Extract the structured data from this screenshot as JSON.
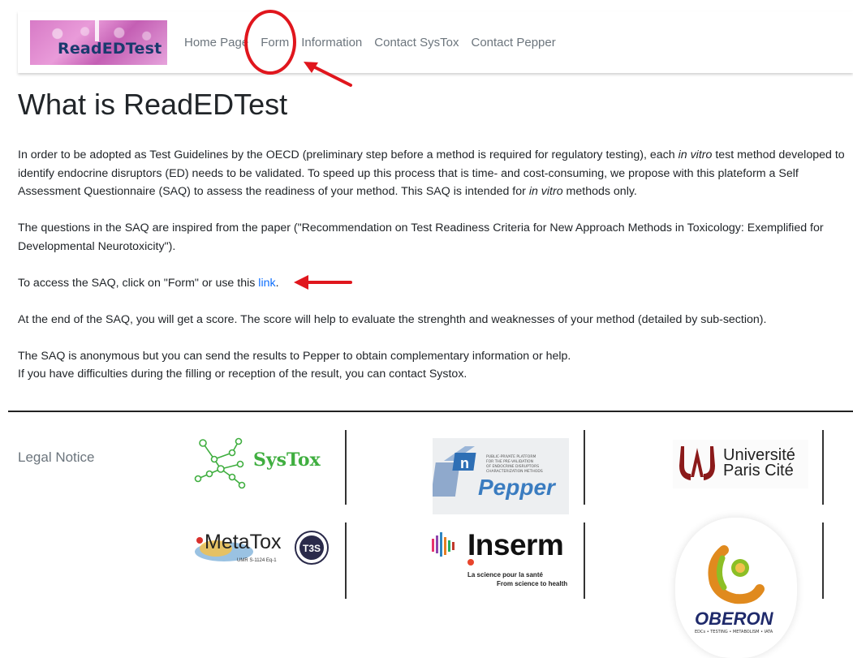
{
  "navbar": {
    "logo_text": "ReadEDTest",
    "links": [
      "Home Page",
      "Form",
      "Information",
      "Contact SysTox",
      "Contact Pepper"
    ]
  },
  "main": {
    "title": "What is ReadEDTest",
    "p1_a": "In order to be adopted as Test Guidelines by the OECD (preliminary step before a method is required for regulatory testing), each ",
    "p1_em1": "in vitro",
    "p1_b": " test method developed to identify endocrine disruptors (ED) needs to be validated. To speed up this process that is time- and cost-consuming, we propose with this plateform a Self Assessment Questionnaire (SAQ) to assess the readiness of your method. This SAQ is intended for ",
    "p1_em2": "in vitro",
    "p1_c": " methods only.",
    "p2": "The questions in the SAQ are inspired from the paper (\"Recommendation on Test Readiness Criteria for New Approach Methods in Toxicology: Exemplified for Developmental Neurotoxicity\").",
    "p3_a": "To access the SAQ, click on \"Form\" or use this ",
    "p3_link": "link",
    "p3_b": ".",
    "p4": "At the end of the SAQ, you will get a score. The score will help to evaluate the strenghth and weaknesses of your method (detailed by sub-section).",
    "p5": "The SAQ is anonymous but you can send the results to Pepper to obtain complementary information or help.",
    "p6": "If you have difficulties during the filling or reception of the result, you can contact Systox."
  },
  "footer": {
    "legal_notice": "Legal Notice",
    "systox": "SysTox",
    "pepper_caption": "PUBLIC-PRIVATE PLATFORM FOR THE PRE-VALIDATION OF ENDOCRINE DISRUPTORS CHARACTERIZATION METHODS",
    "pepper": "Pepper",
    "univ_line1": "Université",
    "univ_line2": "Paris Cité",
    "metatox": "MetaTox",
    "metatox_sub": "UMR S-1124 Eq-1",
    "inserm": "Inserm",
    "inserm_sub1": "La science pour la santé",
    "inserm_sub2": "From science to health",
    "oberon": "OBERON",
    "oberon_sub": "EDCs • TESTING • METABOLISM • IATA"
  },
  "colors": {
    "annotation_red": "#e0161d",
    "link_blue": "#0d6efd",
    "systox_green": "#3fae3f",
    "pepper_blue": "#3a7cc0",
    "univ_red": "#8b1a1a"
  }
}
